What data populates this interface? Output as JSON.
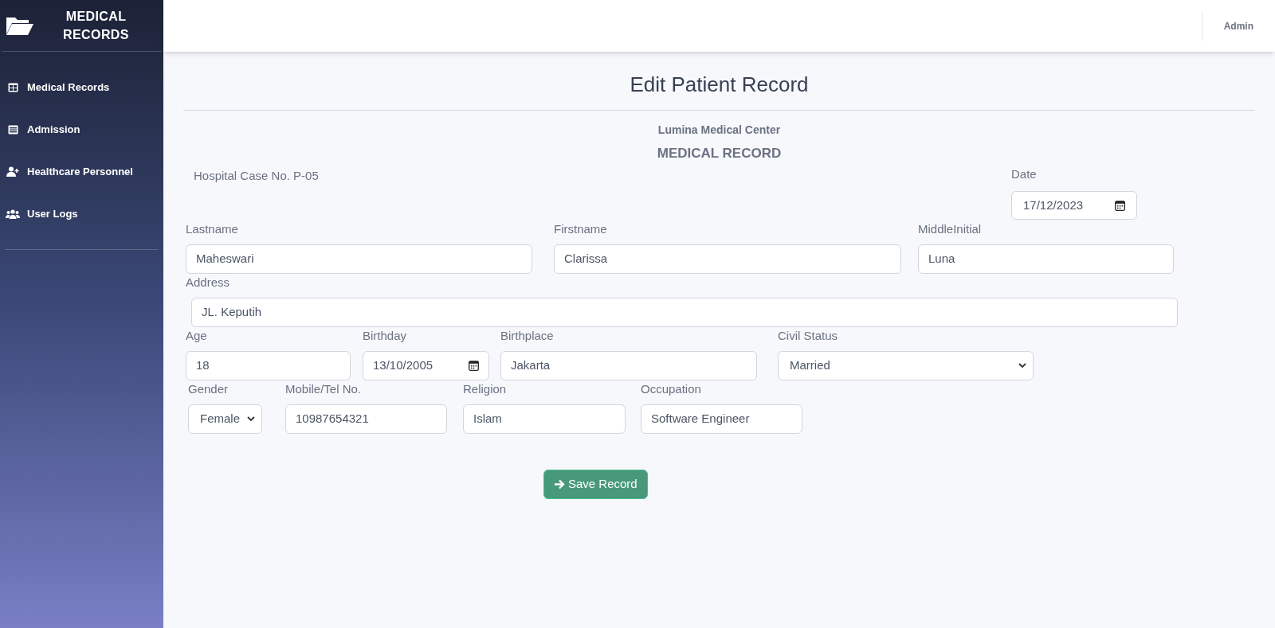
{
  "sidebar": {
    "title": "MEDICAL RECORDS",
    "items": [
      {
        "label": "Medical Records",
        "kind": "table"
      },
      {
        "label": "Admission",
        "kind": "list"
      },
      {
        "label": "Healthcare Personnel",
        "kind": "user-plus"
      },
      {
        "label": "User Logs",
        "kind": "users"
      }
    ]
  },
  "header": {
    "user": "Admin"
  },
  "page_title": "Edit Patient Record",
  "record": {
    "hospital": "Lumina Medical Center",
    "heading": "MEDICAL RECORD",
    "case_no": "Hospital Case No. P-05",
    "date": {
      "label": "Date",
      "value": "17/12/2023"
    },
    "rows": [
      [
        {
          "label": "Lastname",
          "value": "Maheswari",
          "kind": "text"
        },
        {
          "label": "Firstname",
          "value": "Clarissa",
          "kind": "text"
        },
        {
          "label": "MiddleInitial",
          "value": "Luna",
          "kind": "text"
        }
      ],
      [
        {
          "label": "Address",
          "value": "JL. Keputih",
          "kind": "text"
        }
      ],
      [
        {
          "label": "Age",
          "value": "18",
          "kind": "text"
        },
        {
          "label": "Birthday",
          "value": "13/10/2005",
          "kind": "date"
        },
        {
          "label": "Birthplace",
          "value": "Jakarta",
          "kind": "text"
        },
        {
          "label": "Civil Status",
          "value": "Married",
          "kind": "select"
        }
      ],
      [
        {
          "label": "Gender",
          "value": "Female",
          "kind": "select"
        },
        {
          "label": "Mobile/Tel No.",
          "value": "10987654321",
          "kind": "text"
        },
        {
          "label": "Religion",
          "value": "Islam",
          "kind": "text"
        },
        {
          "label": "Occupation",
          "value": "Software Engineer",
          "kind": "text"
        }
      ]
    ]
  },
  "save_button": "Save Record"
}
